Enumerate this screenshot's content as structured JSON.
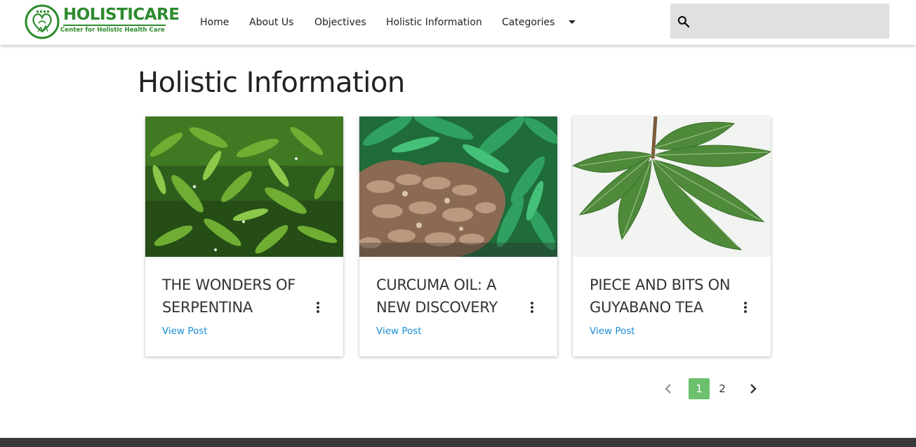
{
  "brand": {
    "name": "HOLISTICARE",
    "tagline": "Center for Holistic Health Care",
    "color": "#2e8b2e"
  },
  "nav": {
    "items": [
      {
        "label": "Home"
      },
      {
        "label": "About Us"
      },
      {
        "label": "Objectives"
      },
      {
        "label": "Holistic Information"
      },
      {
        "label": "Categories",
        "has_dropdown": true
      }
    ]
  },
  "search": {
    "icon": "search-icon",
    "value": "",
    "placeholder": ""
  },
  "page": {
    "title": "Holistic Information"
  },
  "posts": [
    {
      "title": "THE WONDERS OF SERPENTINA",
      "link_label": "View Post",
      "image": "serpentina-plant-photo"
    },
    {
      "title": "CURCUMA OIL: A NEW DISCOVERY",
      "link_label": "View Post",
      "image": "curcuma-roots-photo"
    },
    {
      "title": "PIECE AND BITS ON GUYABANO TEA",
      "link_label": "View Post",
      "image": "guyabano-leaves-photo"
    }
  ],
  "pagination": {
    "pages": [
      "1",
      "2"
    ],
    "current": "1",
    "active_color": "#6cc06e"
  },
  "colors": {
    "link": "#1a8fd8",
    "footer": "#3a3a3a",
    "search_bg": "#e0e0e0"
  }
}
